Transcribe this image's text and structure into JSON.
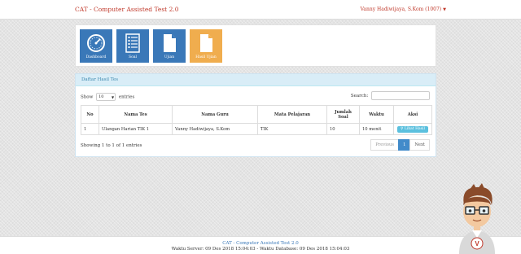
{
  "navbar": {
    "brand": "CAT - Computer Assisted Test 2.0",
    "user": "Vanny Hadiwijaya, S.Kom (1007)"
  },
  "tiles": [
    {
      "label": "Dashboard",
      "icon": "dashboard-icon",
      "color": "#3a78b8"
    },
    {
      "label": "Soal",
      "icon": "list-icon",
      "color": "#3a78b8"
    },
    {
      "label": "Ujian",
      "icon": "document-icon",
      "color": "#3a78b8"
    },
    {
      "label": "Hasil Ujian",
      "icon": "document-icon",
      "color": "#f0ad4e"
    }
  ],
  "panel": {
    "title": "Daftar Hasil Tes",
    "show_label": "Show",
    "entries_label": "entries",
    "length_value": "10",
    "search_label": "Search:",
    "columns": [
      "No",
      "Nama Tes",
      "Nama Guru",
      "Mata Pelajaran",
      "Jumlah Soal",
      "Waktu",
      "Aksi"
    ],
    "rows": [
      {
        "no": "1",
        "nama_tes": "Ulangan Harian TIK 1",
        "nama_guru": "Vanny Hadiwijaya, S.Kom",
        "mapel": "TIK",
        "jumlah_soal": "10",
        "waktu": "10 menit",
        "aksi": "Lihat Hasil"
      }
    ],
    "info": "Showing 1 to 1 of 1 entries",
    "pager": {
      "previous": "Previous",
      "current": "1",
      "next": "Next"
    }
  },
  "footer": {
    "title": "CAT - Computer Assisted Test 2.0",
    "time": "Waktu Server: 09 Des 2018 15:04:03 - Waktu Database: 09 Des 2018 15:04:03"
  }
}
